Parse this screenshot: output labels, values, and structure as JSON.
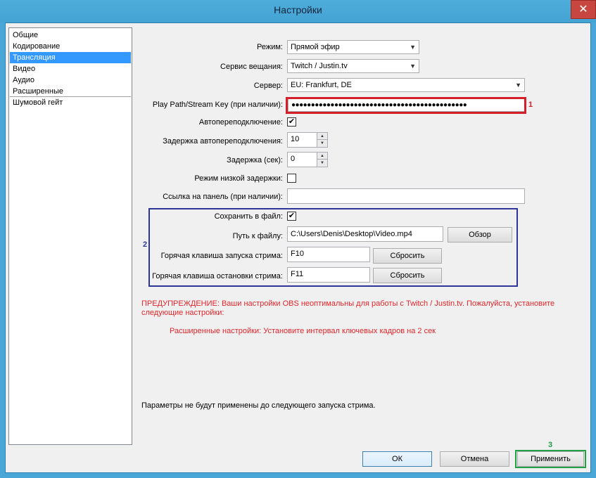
{
  "window": {
    "title": "Настройки",
    "close_glyph": "✕"
  },
  "sidebar": {
    "items": [
      {
        "label": "Общие"
      },
      {
        "label": "Кодирование"
      },
      {
        "label": "Трансляция"
      },
      {
        "label": "Видео"
      },
      {
        "label": "Аудио"
      },
      {
        "label": "Расширенные"
      },
      {
        "label": "Шумовой гейт"
      }
    ],
    "selected_index": 2
  },
  "form": {
    "mode": {
      "label": "Режим:",
      "value": "Прямой эфир"
    },
    "service": {
      "label": "Сервис вещания:",
      "value": "Twitch / Justin.tv"
    },
    "server": {
      "label": "Сервер:",
      "value": "EU: Frankfurt, DE"
    },
    "stream_key": {
      "label": "Play Path/Stream Key (при наличии):",
      "value": "●●●●●●●●●●●●●●●●●●●●●●●●●●●●●●●●●●●●●●●●●●●●●"
    },
    "auto_reconnect": {
      "label": "Автопереподключение:",
      "checked": "✔"
    },
    "reconnect_delay": {
      "label": "Задержка автопереподключения:",
      "value": "10"
    },
    "delay": {
      "label": "Задержка (сек):",
      "value": "0"
    },
    "low_latency": {
      "label": "Режим низкой задержки:",
      "checked": ""
    },
    "dashboard_link": {
      "label": "Ссылка на панель (при наличии):",
      "value": ""
    },
    "save_to_file": {
      "label": "Сохранить в файл:",
      "checked": "✔"
    },
    "file_path": {
      "label": "Путь к файлу:",
      "value": "C:\\Users\\Denis\\Desktop\\Video.mp4"
    },
    "browse_label": "Обзор",
    "start_hotkey": {
      "label": "Горячая клавиша запуска стрима:",
      "value": "F10"
    },
    "stop_hotkey": {
      "label": "Горячая клавиша остановки стрима:",
      "value": "F11"
    },
    "reset_label": "Сбросить"
  },
  "warning": {
    "line1": "ПРЕДУПРЕЖДЕНИЕ: Ваши настройки OBS неоптимальны для работы с Twitch / Justin.tv. Пожалуйста, установите",
    "line2": "следующие настройки:",
    "advanced": "Расширенные настройки: Установите интервал ключевых кадров на 2 сек"
  },
  "notice": "Параметры не будут применены до следующего запуска стрима.",
  "buttons": {
    "ok": "ОК",
    "cancel": "Отмена",
    "apply": "Применить"
  },
  "markers": {
    "m1": "1",
    "m2": "2",
    "m3": "3"
  },
  "icons": {
    "dropdown": "▼",
    "spin_up": "▲",
    "spin_down": "▼"
  },
  "colors": {
    "selection": "#3399ff",
    "marker_red": "#d31f27",
    "marker_blue": "#2e3596",
    "marker_green": "#21a045",
    "warning": "#e0262b"
  }
}
